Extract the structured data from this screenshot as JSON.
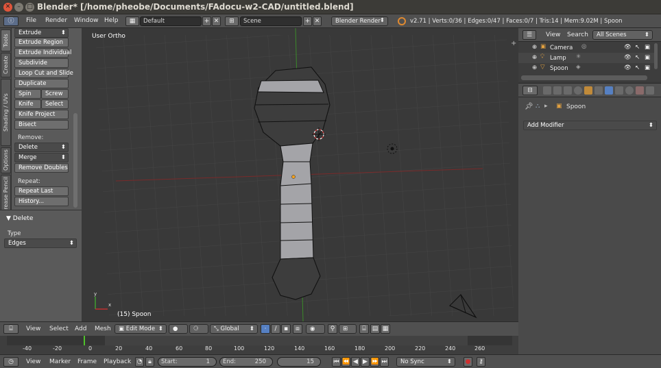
{
  "window": {
    "title": "Blender* [/home/pheobe/Documents/FAdocu-w2-CAD/untitled.blend]"
  },
  "info_header": {
    "menus": [
      "File",
      "Render",
      "Window",
      "Help"
    ],
    "layout": "Default",
    "scene": "Scene",
    "engine": "Blender Render",
    "stats": "v2.71 | Verts:0/36 | Edges:0/47 | Faces:0/7 | Tris:14 | Mem:9.02M | Spoon"
  },
  "tool_tabs": [
    "Tools",
    "Create",
    "Shading / UVs",
    "Options",
    "Grease Pencil"
  ],
  "tool_shelf": {
    "extrude": "Extrude",
    "extrude_region": "Extrude Region",
    "extrude_individual": "Extrude Individual",
    "subdivide": "Subdivide",
    "loop_cut": "Loop Cut and Slide",
    "duplicate": "Duplicate",
    "spin": "Spin",
    "screw": "Screw",
    "knife": "Knife",
    "select": "Select",
    "knife_project": "Knife Project",
    "bisect": "Bisect",
    "remove_label": "Remove:",
    "delete": "Delete",
    "merge": "Merge",
    "remove_doubles": "Remove Doubles",
    "repeat_label": "Repeat:",
    "repeat_last": "Repeat Last",
    "history": "History..."
  },
  "operator_panel": {
    "title": "Delete",
    "type_label": "Type",
    "type_value": "Edges"
  },
  "viewport": {
    "view_name": "User Ortho",
    "object_label": "(15) Spoon"
  },
  "viewport_header": {
    "menus": [
      "View",
      "Select",
      "Add",
      "Mesh"
    ],
    "mode": "Edit Mode",
    "orientation": "Global"
  },
  "timeline": {
    "ticks": [
      "-40",
      "-20",
      "0",
      "20",
      "40",
      "60",
      "80",
      "100",
      "120",
      "140",
      "160",
      "180",
      "200",
      "220",
      "240",
      "260"
    ],
    "current_frame_fraction": 0.0577
  },
  "timeline_header": {
    "menus": [
      "View",
      "Marker",
      "Frame",
      "Playback"
    ],
    "start_label": "Start:",
    "start": "1",
    "end_label": "End:",
    "end": "250",
    "current": "15",
    "sync": "No Sync"
  },
  "outliner": {
    "menus": [
      "View",
      "Search"
    ],
    "filter": "All Scenes",
    "items": [
      "Camera",
      "Lamp",
      "Spoon"
    ]
  },
  "properties": {
    "object_name": "Spoon",
    "add_modifier": "Add Modifier"
  },
  "colors": {
    "accent": "#5680c2",
    "vertex": "#f0a020",
    "grid_x": "#8e2a2a",
    "grid_y": "#3f8a2a"
  }
}
